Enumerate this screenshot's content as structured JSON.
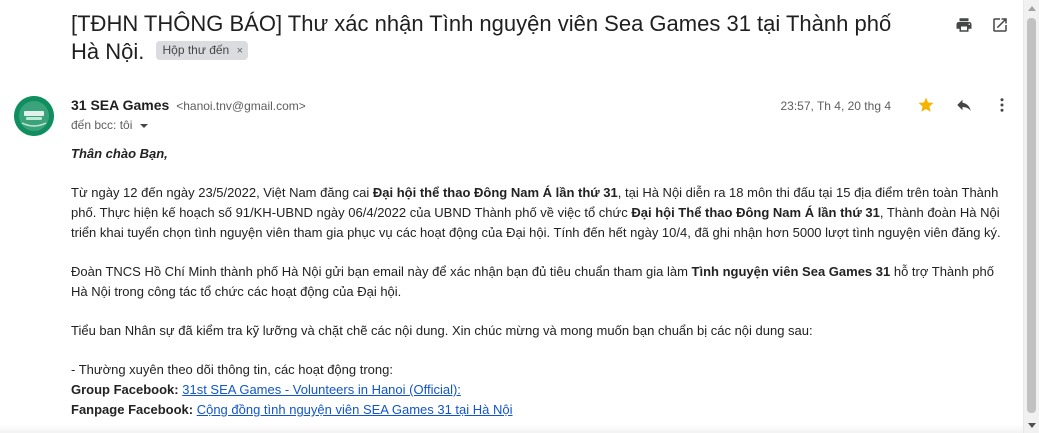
{
  "email": {
    "subject": "[TĐHN THÔNG BÁO] Thư xác nhận Tình nguyện viên Sea Games 31 tại Thành phố Hà Nội.",
    "label": "Hộp thư đến",
    "label_remove": "×",
    "sender_name": "31 SEA Games",
    "sender_email": "<hanoi.tnv@gmail.com>",
    "recipient": "đến bcc: tôi",
    "date": "23:57, Th 4, 20 thg 4",
    "starred": true
  },
  "icons": {
    "print": "print-icon",
    "open_new_window": "open-in-new-window-icon",
    "star": "star-icon",
    "reply": "reply-icon",
    "more": "more-vertical-icon",
    "chevron": "chevron-down-icon"
  },
  "colors": {
    "star": "#f4b400",
    "link": "#1155cc",
    "avatar": "#0f8f5f",
    "chip": "#dadce0"
  },
  "body": {
    "greeting": "Thân chào Bạn,",
    "p1_a": "Từ ngày 12 đến ngày 23/5/2022, Việt Nam đăng cai ",
    "p1_b": "Đại hội thể thao Đông Nam Á lần thứ 31",
    "p1_c": ", tại Hà Nội diễn ra 18 môn thi đấu tại 15 địa điểm trên toàn Thành phố. Thực hiện kế hoạch số 91/KH-UBND ngày 06/4/2022 của UBND Thành phố về việc tổ chức ",
    "p1_d": "Đại hội Thể thao Đông Nam Á lần thứ 31",
    "p1_e": ", Thành đoàn Hà Nội triển khai tuyển chọn tình nguyện viên tham gia phục vụ các hoạt động của Đại hội. Tính đến hết ngày 10/4, đã ghi nhận hơn 5000 lượt tình nguyện viên đăng ký.",
    "p2_a": "Đoàn TNCS Hồ Chí Minh thành phố Hà Nội gửi bạn email này để xác nhận bạn đủ tiêu chuẩn tham gia làm ",
    "p2_b": "Tình nguyện viên Sea Games 31",
    "p2_c": " hỗ trợ Thành phố Hà Nội trong công tác tổ chức các hoạt động của Đại hội.",
    "p3": "Tiểu ban Nhân sự đã kiểm tra kỹ lưỡng và chặt chẽ các nội dung. Xin chúc mừng và mong muốn bạn chuẩn bị các nội dung sau:",
    "list_intro": "- Thường xuyên theo dõi thông tin, các hoạt động trong:",
    "group_label": "Group Facebook:",
    "group_link": "31st SEA Games - Volunteers in Hanoi (Official):",
    "fanpage_label": "Fanpage Facebook:",
    "fanpage_link": "Cộng đồng tình nguyện viên SEA Games 31 tại Hà Nội"
  }
}
